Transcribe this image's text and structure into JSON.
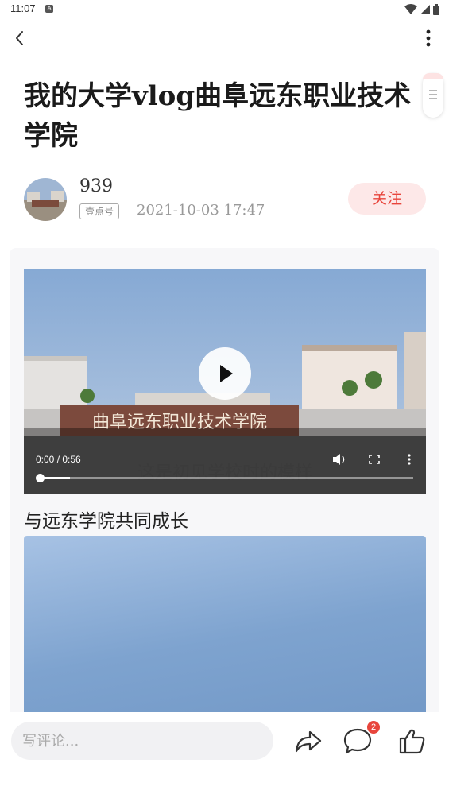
{
  "status_bar": {
    "time": "11:07",
    "notification_icon": "A"
  },
  "header": {
    "back_icon": "chevron-left-icon",
    "more_icon": "more-vertical-icon"
  },
  "article": {
    "title": "我的大学vlog曲阜远东职业技术学院",
    "author": {
      "name": "939",
      "badge": "壹点号",
      "date": "2021-10-03  17:47",
      "follow_label": "关注"
    },
    "video": {
      "current_time": "0:00 / 0:56",
      "progress": 0.08,
      "sign_text": "曲阜远东职业技术学院",
      "subtitle": "这是初见学校时的模样"
    },
    "caption": "与远东学院共同成长"
  },
  "bottom_bar": {
    "comment_placeholder": "写评论...",
    "comment_count": "2",
    "icons": [
      "share-icon",
      "comment-icon",
      "like-icon"
    ]
  },
  "colors": {
    "accent": "#e8453c",
    "follow_bg": "#fde8e8",
    "sky": "#8fb0d6"
  }
}
